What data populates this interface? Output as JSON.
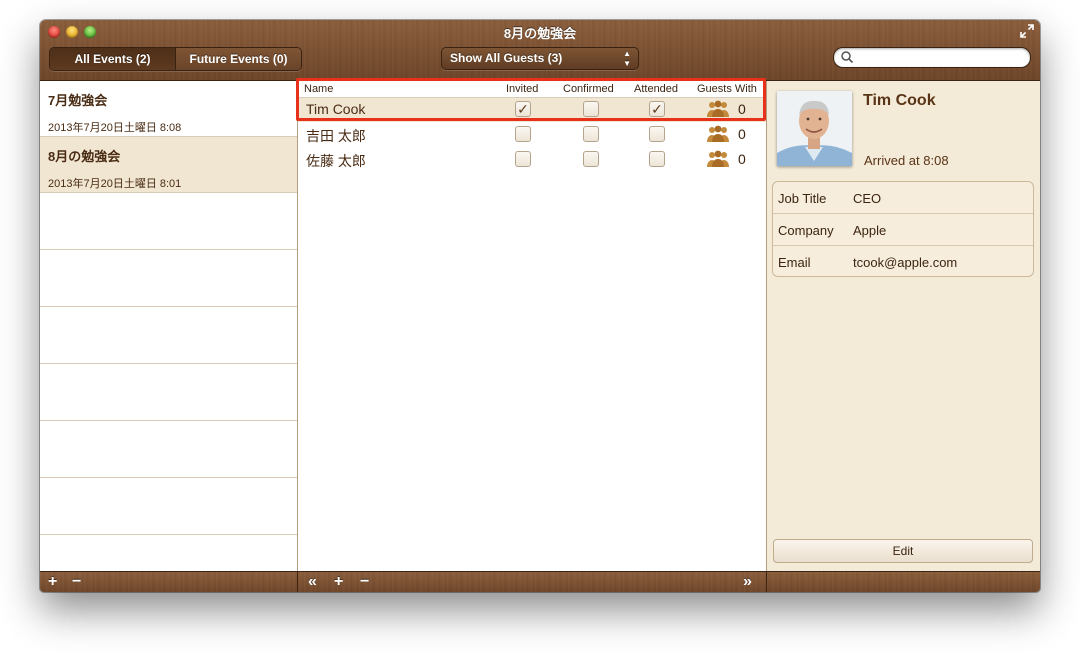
{
  "window": {
    "title": "8月の勉強会"
  },
  "toolbar": {
    "tabs": [
      {
        "label": "All Events (2)",
        "active": true
      },
      {
        "label": "Future Events (0)",
        "active": false
      }
    ],
    "guest_filter": "Show All Guests (3)",
    "search_placeholder": ""
  },
  "events": [
    {
      "title": "7月勉強会",
      "date": "2013年7月20日土曜日 8:08",
      "selected": false
    },
    {
      "title": "8月の勉強会",
      "date": "2013年7月20日土曜日 8:01",
      "selected": true
    }
  ],
  "guest_table": {
    "columns": {
      "name": "Name",
      "invited": "Invited",
      "confirmed": "Confirmed",
      "attended": "Attended",
      "guests_with": "Guests With"
    },
    "rows": [
      {
        "name": "Tim Cook",
        "invited": true,
        "confirmed": false,
        "attended": true,
        "guests_with": "0",
        "selected": true
      },
      {
        "name": "吉田 太郎",
        "invited": false,
        "confirmed": false,
        "attended": false,
        "guests_with": "0",
        "selected": false
      },
      {
        "name": "佐藤 太郎",
        "invited": false,
        "confirmed": false,
        "attended": false,
        "guests_with": "0",
        "selected": false
      }
    ]
  },
  "contact": {
    "name": "Tim Cook",
    "status": "Arrived at 8:08",
    "fields": [
      {
        "key": "Job Title",
        "value": "CEO"
      },
      {
        "key": "Company",
        "value": "Apple"
      },
      {
        "key": "Email",
        "value": "tcook@apple.com"
      }
    ],
    "edit_label": "Edit"
  },
  "bottom": {
    "add": "+",
    "remove": "−",
    "collapse": "«",
    "expand": "»"
  },
  "colors": {
    "wood": "#7a4f30",
    "highlight": "#e8311a",
    "text_brown": "#4a2c14"
  }
}
